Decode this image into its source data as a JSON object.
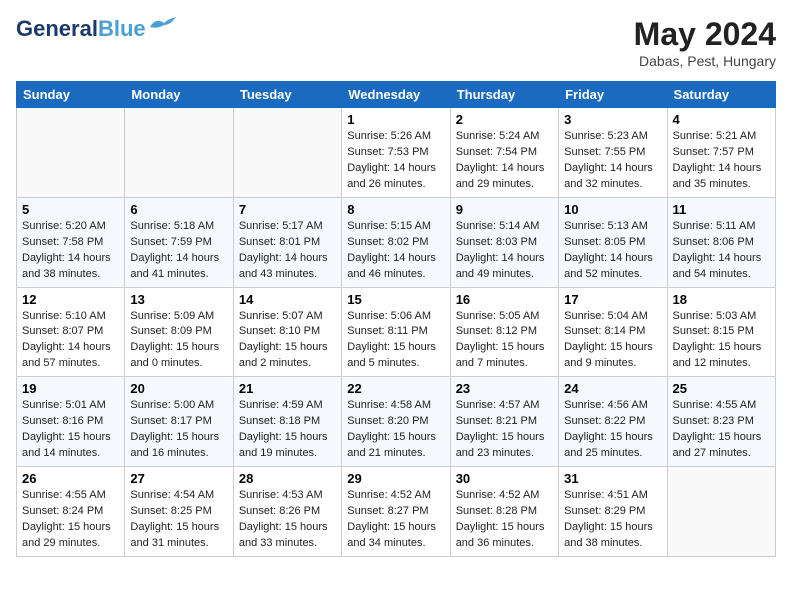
{
  "header": {
    "logo_general": "General",
    "logo_blue": "Blue",
    "month": "May 2024",
    "location": "Dabas, Pest, Hungary"
  },
  "days_of_week": [
    "Sunday",
    "Monday",
    "Tuesday",
    "Wednesday",
    "Thursday",
    "Friday",
    "Saturday"
  ],
  "weeks": [
    [
      {
        "day": "",
        "info": ""
      },
      {
        "day": "",
        "info": ""
      },
      {
        "day": "",
        "info": ""
      },
      {
        "day": "1",
        "info": "Sunrise: 5:26 AM\nSunset: 7:53 PM\nDaylight: 14 hours and 26 minutes."
      },
      {
        "day": "2",
        "info": "Sunrise: 5:24 AM\nSunset: 7:54 PM\nDaylight: 14 hours and 29 minutes."
      },
      {
        "day": "3",
        "info": "Sunrise: 5:23 AM\nSunset: 7:55 PM\nDaylight: 14 hours and 32 minutes."
      },
      {
        "day": "4",
        "info": "Sunrise: 5:21 AM\nSunset: 7:57 PM\nDaylight: 14 hours and 35 minutes."
      }
    ],
    [
      {
        "day": "5",
        "info": "Sunrise: 5:20 AM\nSunset: 7:58 PM\nDaylight: 14 hours and 38 minutes."
      },
      {
        "day": "6",
        "info": "Sunrise: 5:18 AM\nSunset: 7:59 PM\nDaylight: 14 hours and 41 minutes."
      },
      {
        "day": "7",
        "info": "Sunrise: 5:17 AM\nSunset: 8:01 PM\nDaylight: 14 hours and 43 minutes."
      },
      {
        "day": "8",
        "info": "Sunrise: 5:15 AM\nSunset: 8:02 PM\nDaylight: 14 hours and 46 minutes."
      },
      {
        "day": "9",
        "info": "Sunrise: 5:14 AM\nSunset: 8:03 PM\nDaylight: 14 hours and 49 minutes."
      },
      {
        "day": "10",
        "info": "Sunrise: 5:13 AM\nSunset: 8:05 PM\nDaylight: 14 hours and 52 minutes."
      },
      {
        "day": "11",
        "info": "Sunrise: 5:11 AM\nSunset: 8:06 PM\nDaylight: 14 hours and 54 minutes."
      }
    ],
    [
      {
        "day": "12",
        "info": "Sunrise: 5:10 AM\nSunset: 8:07 PM\nDaylight: 14 hours and 57 minutes."
      },
      {
        "day": "13",
        "info": "Sunrise: 5:09 AM\nSunset: 8:09 PM\nDaylight: 15 hours and 0 minutes."
      },
      {
        "day": "14",
        "info": "Sunrise: 5:07 AM\nSunset: 8:10 PM\nDaylight: 15 hours and 2 minutes."
      },
      {
        "day": "15",
        "info": "Sunrise: 5:06 AM\nSunset: 8:11 PM\nDaylight: 15 hours and 5 minutes."
      },
      {
        "day": "16",
        "info": "Sunrise: 5:05 AM\nSunset: 8:12 PM\nDaylight: 15 hours and 7 minutes."
      },
      {
        "day": "17",
        "info": "Sunrise: 5:04 AM\nSunset: 8:14 PM\nDaylight: 15 hours and 9 minutes."
      },
      {
        "day": "18",
        "info": "Sunrise: 5:03 AM\nSunset: 8:15 PM\nDaylight: 15 hours and 12 minutes."
      }
    ],
    [
      {
        "day": "19",
        "info": "Sunrise: 5:01 AM\nSunset: 8:16 PM\nDaylight: 15 hours and 14 minutes."
      },
      {
        "day": "20",
        "info": "Sunrise: 5:00 AM\nSunset: 8:17 PM\nDaylight: 15 hours and 16 minutes."
      },
      {
        "day": "21",
        "info": "Sunrise: 4:59 AM\nSunset: 8:18 PM\nDaylight: 15 hours and 19 minutes."
      },
      {
        "day": "22",
        "info": "Sunrise: 4:58 AM\nSunset: 8:20 PM\nDaylight: 15 hours and 21 minutes."
      },
      {
        "day": "23",
        "info": "Sunrise: 4:57 AM\nSunset: 8:21 PM\nDaylight: 15 hours and 23 minutes."
      },
      {
        "day": "24",
        "info": "Sunrise: 4:56 AM\nSunset: 8:22 PM\nDaylight: 15 hours and 25 minutes."
      },
      {
        "day": "25",
        "info": "Sunrise: 4:55 AM\nSunset: 8:23 PM\nDaylight: 15 hours and 27 minutes."
      }
    ],
    [
      {
        "day": "26",
        "info": "Sunrise: 4:55 AM\nSunset: 8:24 PM\nDaylight: 15 hours and 29 minutes."
      },
      {
        "day": "27",
        "info": "Sunrise: 4:54 AM\nSunset: 8:25 PM\nDaylight: 15 hours and 31 minutes."
      },
      {
        "day": "28",
        "info": "Sunrise: 4:53 AM\nSunset: 8:26 PM\nDaylight: 15 hours and 33 minutes."
      },
      {
        "day": "29",
        "info": "Sunrise: 4:52 AM\nSunset: 8:27 PM\nDaylight: 15 hours and 34 minutes."
      },
      {
        "day": "30",
        "info": "Sunrise: 4:52 AM\nSunset: 8:28 PM\nDaylight: 15 hours and 36 minutes."
      },
      {
        "day": "31",
        "info": "Sunrise: 4:51 AM\nSunset: 8:29 PM\nDaylight: 15 hours and 38 minutes."
      },
      {
        "day": "",
        "info": ""
      }
    ]
  ]
}
